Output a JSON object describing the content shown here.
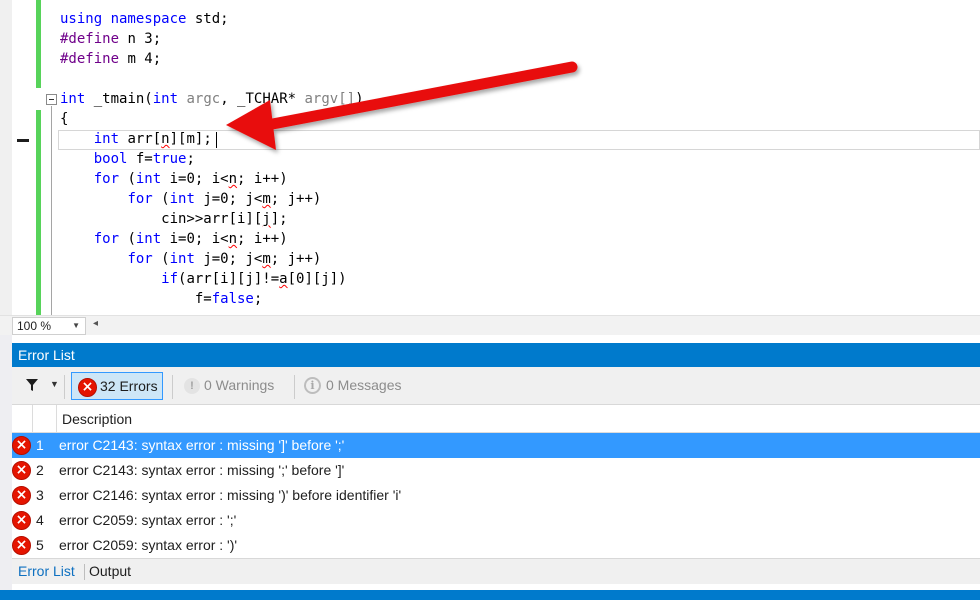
{
  "editor": {
    "lines": [
      {
        "id": "l1",
        "segs": [
          {
            "t": "using namespace",
            "c": "kw"
          },
          {
            "t": " std;",
            "c": ""
          }
        ]
      },
      {
        "id": "l2",
        "segs": [
          {
            "t": "#define",
            "c": "pp"
          },
          {
            "t": " n 3;",
            "c": ""
          }
        ]
      },
      {
        "id": "l3",
        "segs": [
          {
            "t": "#define",
            "c": "pp"
          },
          {
            "t": " m 4;",
            "c": ""
          }
        ]
      },
      {
        "id": "l4",
        "segs": []
      },
      {
        "id": "l5",
        "segs": [
          {
            "t": "int",
            "c": "kw"
          },
          {
            "t": " _tmain(",
            "c": ""
          },
          {
            "t": "int",
            "c": "kw"
          },
          {
            "t": " ",
            "c": ""
          },
          {
            "t": "argc",
            "c": "param"
          },
          {
            "t": ", _TCHAR* ",
            "c": ""
          },
          {
            "t": "argv[]",
            "c": "param"
          },
          {
            "t": ")",
            "c": ""
          }
        ]
      },
      {
        "id": "l6",
        "segs": [
          {
            "t": "{",
            "c": ""
          }
        ]
      },
      {
        "id": "l7",
        "segs": [
          {
            "t": "    ",
            "c": ""
          },
          {
            "t": "int",
            "c": "kw"
          },
          {
            "t": " arr[",
            "c": ""
          },
          {
            "t": "n",
            "c": "squig"
          },
          {
            "t": "][m];",
            "c": ""
          }
        ]
      },
      {
        "id": "l8",
        "segs": [
          {
            "t": "    ",
            "c": ""
          },
          {
            "t": "bool",
            "c": "kw"
          },
          {
            "t": " f=",
            "c": ""
          },
          {
            "t": "true",
            "c": "kw"
          },
          {
            "t": ";",
            "c": ""
          }
        ]
      },
      {
        "id": "l9",
        "segs": [
          {
            "t": "    ",
            "c": ""
          },
          {
            "t": "for",
            "c": "kw"
          },
          {
            "t": " (",
            "c": ""
          },
          {
            "t": "int",
            "c": "kw"
          },
          {
            "t": " i=0; i<",
            "c": ""
          },
          {
            "t": "n",
            "c": "squig"
          },
          {
            "t": "; i++)",
            "c": ""
          }
        ]
      },
      {
        "id": "l10",
        "segs": [
          {
            "t": "        ",
            "c": ""
          },
          {
            "t": "for",
            "c": "kw"
          },
          {
            "t": " (",
            "c": ""
          },
          {
            "t": "int",
            "c": "kw"
          },
          {
            "t": " j=0; j<",
            "c": ""
          },
          {
            "t": "m",
            "c": "squig"
          },
          {
            "t": "; j++)",
            "c": ""
          }
        ]
      },
      {
        "id": "l11",
        "segs": [
          {
            "t": "            cin>>arr[i][",
            "c": ""
          },
          {
            "t": "j",
            "c": "squig"
          },
          {
            "t": "];",
            "c": ""
          }
        ]
      },
      {
        "id": "l12",
        "segs": [
          {
            "t": "    ",
            "c": ""
          },
          {
            "t": "for",
            "c": "kw"
          },
          {
            "t": " (",
            "c": ""
          },
          {
            "t": "int",
            "c": "kw"
          },
          {
            "t": " i=0; i<",
            "c": ""
          },
          {
            "t": "n",
            "c": "squig"
          },
          {
            "t": "; i++)",
            "c": ""
          }
        ]
      },
      {
        "id": "l13",
        "segs": [
          {
            "t": "        ",
            "c": ""
          },
          {
            "t": "for",
            "c": "kw"
          },
          {
            "t": " (",
            "c": ""
          },
          {
            "t": "int",
            "c": "kw"
          },
          {
            "t": " j=0; j<",
            "c": ""
          },
          {
            "t": "m",
            "c": "squig"
          },
          {
            "t": "; j++)",
            "c": ""
          }
        ]
      },
      {
        "id": "l14",
        "segs": [
          {
            "t": "            ",
            "c": ""
          },
          {
            "t": "if",
            "c": "kw"
          },
          {
            "t": "(arr[i][j]!=",
            "c": ""
          },
          {
            "t": "a",
            "c": "squig"
          },
          {
            "t": "[0][j])",
            "c": ""
          }
        ]
      },
      {
        "id": "l15",
        "segs": [
          {
            "t": "                f=",
            "c": ""
          },
          {
            "t": "false",
            "c": "kw"
          },
          {
            "t": ";",
            "c": ""
          }
        ]
      }
    ],
    "zoom": "100 %",
    "colors": {
      "keyword": "#0000ff",
      "preprocessor": "#6f008a",
      "change_bar": "#57d35a",
      "arrow": "#e81010"
    }
  },
  "error_list": {
    "title": "Error List",
    "filters": {
      "errors": "32 Errors",
      "warnings": "0 Warnings",
      "messages": "0 Messages"
    },
    "columns": {
      "description": "Description"
    },
    "rows": [
      {
        "num": "1",
        "desc": "error C2143: syntax error : missing ']' before ';'"
      },
      {
        "num": "2",
        "desc": "error C2143: syntax error : missing ';' before ']'"
      },
      {
        "num": "3",
        "desc": "error C2146: syntax error : missing ')' before identifier 'i'"
      },
      {
        "num": "4",
        "desc": "error C2059: syntax error : ';'"
      },
      {
        "num": "5",
        "desc": "error C2059: syntax error : ')'"
      }
    ],
    "colors": {
      "title_bar": "#007acc",
      "selection": "#3399ff",
      "error_icon": "#e51400"
    }
  },
  "bottom_tabs": {
    "error_list": "Error List",
    "output": "Output"
  }
}
